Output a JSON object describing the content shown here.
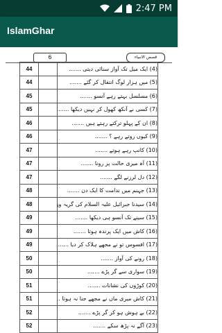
{
  "status_bar": {
    "time": "2:47 PM",
    "icons": [
      "wifi-icon",
      "signal-icon",
      "battery-icon"
    ]
  },
  "app_bar": {
    "title": "IslamGhar"
  },
  "page_header": {
    "page_number": "6",
    "book_title": "قصص الانبیاء"
  },
  "toc": {
    "rows": [
      {
        "page": "44",
        "entry": "(4) ایک میل تک آواز سنائی دیتی ......."
      },
      {
        "page": "44",
        "entry": "(5) میں ہزار لوگ انتقال کر گئے ......."
      },
      {
        "page": "45",
        "entry": "(6) مسلسل بہتے رہے آنسو ......."
      },
      {
        "page": "45",
        "entry": "(7) کسی نے آنکھ کھول کر نہیں دیکھا ......."
      },
      {
        "page": "46",
        "entry": "(8) ان کے پہلو ترکتے رہتے ہیں ......."
      },
      {
        "page": "46",
        "entry": "(9) کیوں روتے رہے ؟ ......."
      },
      {
        "page": "47",
        "entry": "(10) کانپ رہے ہوتے ......."
      },
      {
        "page": "47",
        "entry": "(11) آہ میری حالت پر رونا ......."
      },
      {
        "page": "47",
        "entry": "(12) دل لرزنے لگے ......."
      },
      {
        "page": "48",
        "entry": "(13) جہنم میں ندامت کا ایک دن ......."
      },
      {
        "page": "48",
        "entry": "(14) سیدنا جبرائیل علیہ السلام کی گریہ وزاری ......."
      },
      {
        "page": "49",
        "entry": "(15) سینے تک آنسو ہی دیکھا ......."
      },
      {
        "page": "49",
        "entry": "(16) کاش میں ایک پرندہ ہوتا ......."
      },
      {
        "page": "49",
        "entry": "(17) افسوس تو نے مجھے ہلاک کر دیا ......."
      },
      {
        "page": "50",
        "entry": "(18) رونے کی آواز ......."
      },
      {
        "page": "50",
        "entry": "(19) سواری سے گر پڑے ......."
      },
      {
        "page": "51",
        "entry": "(20) کوڑوں کی نشانات ......."
      },
      {
        "page": "51",
        "entry": "(21) کاش میری ماں نے مجھے جنا نہ ہوتا ......."
      },
      {
        "page": "52",
        "entry": "(22) بے ہوش ہو کر گر پڑے ......."
      },
      {
        "page": "52",
        "entry": "(23) آگے نہ پڑھ سکے ......."
      }
    ]
  }
}
